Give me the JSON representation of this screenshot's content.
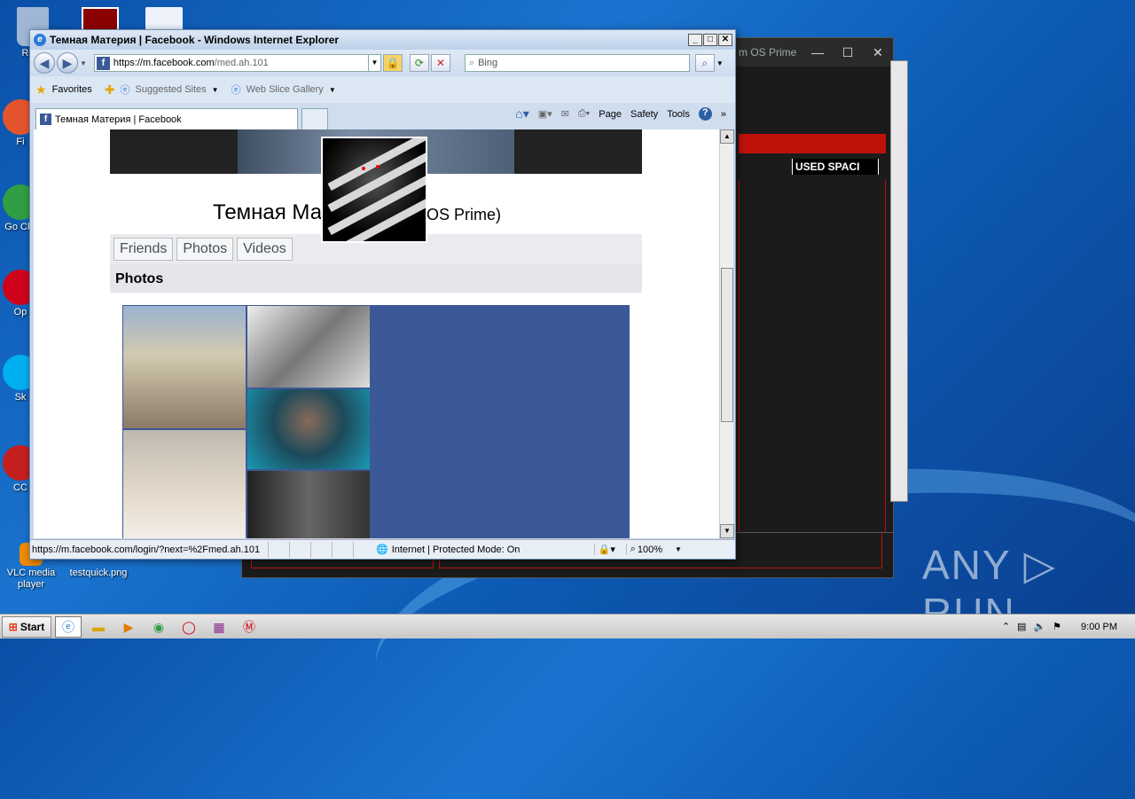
{
  "desktop": {
    "icons": [
      {
        "label": "Recy",
        "color": "#9fb7d4"
      },
      {
        "label": "Fi",
        "color": "#e4552d"
      },
      {
        "label": "Go Chr",
        "color": "#2f9e44"
      },
      {
        "label": "Op",
        "color": "#d0021b"
      },
      {
        "label": "Sk",
        "color": "#00aff0"
      },
      {
        "label": "CC",
        "color": "#c41e1e"
      },
      {
        "label": "VLC media player",
        "color": "#f08a00"
      },
      {
        "label": "testquick.png",
        "color": "#8899aa"
      }
    ]
  },
  "bg_window": {
    "title": "m OS Prime",
    "minimize": "—",
    "maximize": "☐",
    "close": "✕",
    "column": "USED SPACI"
  },
  "ie": {
    "title": "Темная Материя | Facebook - Windows Internet Explorer",
    "address_prefix": "https://m.facebook.com",
    "address_path": "/med.ah.101",
    "search_placeholder": "Bing",
    "favorites": "Favorites",
    "suggested_sites": "Suggested Sites",
    "web_slice": "Web Slice Gallery",
    "tab_title": "Темная Материя | Facebook",
    "cmd": {
      "page": "Page",
      "safety": "Safety",
      "tools": "Tools",
      "help": "?"
    },
    "status_url": "https://m.facebook.com/login/?next=%2Fmed.ah.101",
    "zone": "Internet | Protected Mode: On",
    "zoom": "100%"
  },
  "fb": {
    "name_left": "Темная Ма",
    "name_right": "tim OS Prime)",
    "nav": [
      "Friends",
      "Photos",
      "Videos"
    ],
    "photos_heading": "Photos"
  },
  "taskbar": {
    "start": "Start",
    "clock": "9:00 PM"
  },
  "watermark": "ANY ▷ RUN"
}
